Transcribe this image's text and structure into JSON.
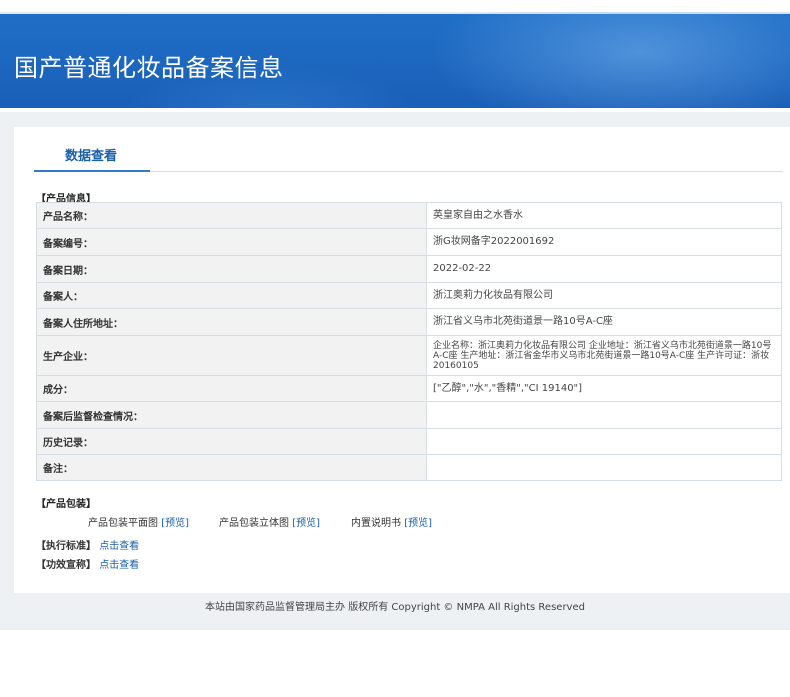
{
  "header": {
    "title": "国产普通化妆品备案信息"
  },
  "tab": {
    "label": "数据查看"
  },
  "sections": {
    "product_info": "【产品信息】",
    "package": "【产品包装】",
    "standard": "【执行标准】",
    "efficacy": "【功效宣称】"
  },
  "rows": [
    {
      "label": "产品名称：",
      "value": "英皇家自由之水香水"
    },
    {
      "label": "备案编号：",
      "value": "浙G妆网备字2022001692"
    },
    {
      "label": "备案日期：",
      "value": "2022-02-22"
    },
    {
      "label": "备案人：",
      "value": "浙江奥莉力化妆品有限公司"
    },
    {
      "label": "备案人住所地址：",
      "value": "浙江省义乌市北苑街道景一路10号A-C座"
    },
    {
      "label": "生产企业：",
      "value": "企业名称：浙江奥莉力化妆品有限公司 企业地址：浙江省义乌市北苑街道景一路10号A-C座 生产地址：浙江省金华市义乌市北苑街道景一路10号A-C座 生产许可证：浙妆20160105"
    },
    {
      "label": "成分：",
      "value": "[\"乙醇\",\"水\",\"香精\",\"CI 19140\"]"
    },
    {
      "label": "备案后监督检查情况：",
      "value": ""
    },
    {
      "label": "历史记录：",
      "value": ""
    },
    {
      "label": "备注：",
      "value": ""
    }
  ],
  "package": {
    "items": [
      {
        "label": "产品包装平面图",
        "link": "[预览]"
      },
      {
        "label": "产品包装立体图",
        "link": "[预览]"
      },
      {
        "label": "内置说明书",
        "link": "[预览]"
      }
    ]
  },
  "standard_link": "点击查看",
  "efficacy_link": "点击查看",
  "footer": {
    "text": "本站由国家药品监督管理局主办 版权所有 Copyright © NMPA All Rights Reserved"
  }
}
